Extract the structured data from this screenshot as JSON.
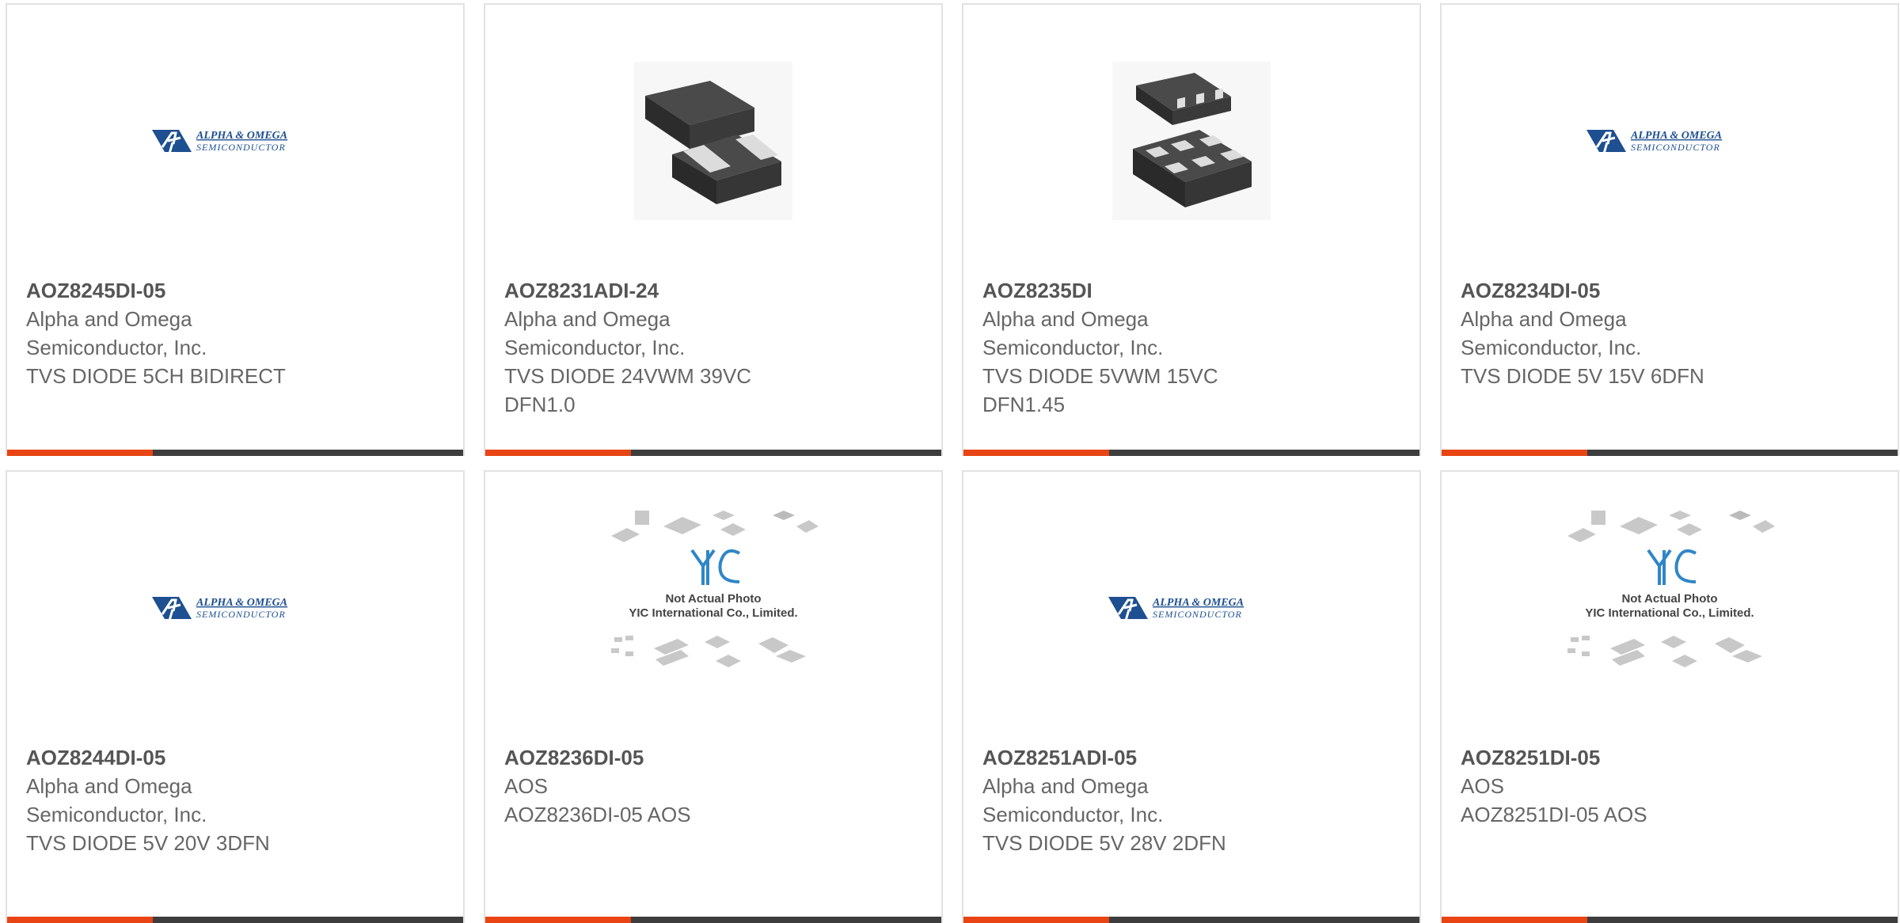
{
  "colors": {
    "accent": "#e84414",
    "bar": "#3d3d3d",
    "brand_blue": "#1d4f91",
    "border": "#e2e2e2"
  },
  "aos_logo": {
    "line1": "ALPHA & OMEGA",
    "line2": "SEMICONDUCTOR"
  },
  "placeholder_image": {
    "brand": "YIC",
    "line1": "Not Actual Photo",
    "line2": "YIC International Co., Limited."
  },
  "products": [
    {
      "part_number": "AOZ8245DI-05",
      "manufacturer_line1": "Alpha and Omega",
      "manufacturer_line2": "Semiconductor, Inc.",
      "desc_line1": "TVS DIODE 5CH BIDIRECT",
      "desc_line2": "",
      "image": "aos-logo-icon"
    },
    {
      "part_number": "AOZ8231ADI-24",
      "manufacturer_line1": "Alpha and Omega",
      "manufacturer_line2": "Semiconductor, Inc.",
      "desc_line1": "TVS DIODE 24VWM 39VC",
      "desc_line2": "DFN1.0",
      "image": "dfn-2pad-package-icon"
    },
    {
      "part_number": "AOZ8235DI",
      "manufacturer_line1": "Alpha and Omega",
      "manufacturer_line2": "Semiconductor, Inc.",
      "desc_line1": "TVS DIODE 5VWM 15VC",
      "desc_line2": "DFN1.45",
      "image": "dfn-6pad-package-icon"
    },
    {
      "part_number": "AOZ8234DI-05",
      "manufacturer_line1": "Alpha and Omega",
      "manufacturer_line2": "Semiconductor, Inc.",
      "desc_line1": "TVS DIODE 5V 15V 6DFN",
      "desc_line2": "",
      "image": "aos-logo-icon"
    },
    {
      "part_number": "AOZ8244DI-05",
      "manufacturer_line1": "Alpha and Omega",
      "manufacturer_line2": "Semiconductor, Inc.",
      "desc_line1": "TVS DIODE 5V 20V 3DFN",
      "desc_line2": "",
      "image": "aos-logo-icon"
    },
    {
      "part_number": "AOZ8236DI-05",
      "manufacturer_line1": "AOS",
      "manufacturer_line2": "AOZ8236DI-05 AOS",
      "desc_line1": "",
      "desc_line2": "",
      "image": "yic-placeholder-icon"
    },
    {
      "part_number": "AOZ8251ADI-05",
      "manufacturer_line1": "Alpha and Omega",
      "manufacturer_line2": "Semiconductor, Inc.",
      "desc_line1": "TVS DIODE 5V 28V 2DFN",
      "desc_line2": "",
      "image": "aos-logo-icon"
    },
    {
      "part_number": "AOZ8251DI-05",
      "manufacturer_line1": "AOS",
      "manufacturer_line2": "AOZ8251DI-05 AOS",
      "desc_line1": "",
      "desc_line2": "",
      "image": "yic-placeholder-icon"
    }
  ]
}
